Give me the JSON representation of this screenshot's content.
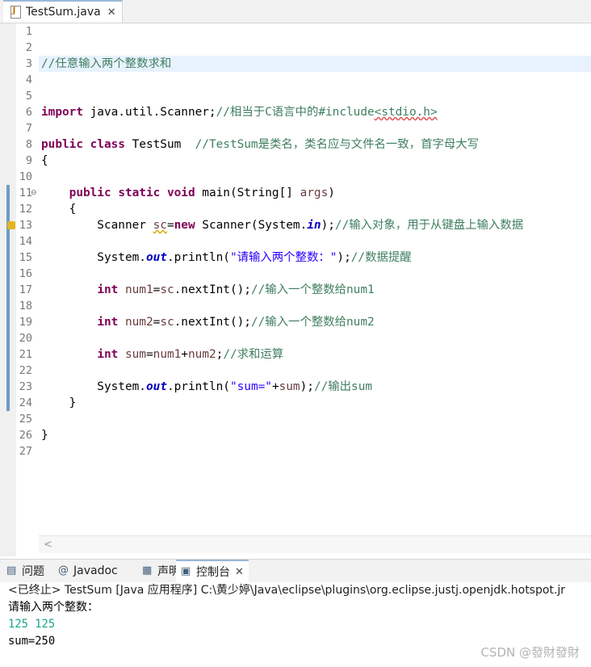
{
  "editor_tab": {
    "label": "TestSum.java",
    "close": "✕"
  },
  "lines": [
    {
      "n": "1",
      "parts": []
    },
    {
      "n": "2",
      "parts": []
    },
    {
      "n": "3",
      "hl": true,
      "parts": [
        {
          "c": "cm",
          "t": "//任意输入两个整数求和"
        }
      ]
    },
    {
      "n": "4",
      "parts": []
    },
    {
      "n": "5",
      "parts": []
    },
    {
      "n": "6",
      "parts": [
        {
          "c": "kw",
          "t": "import"
        },
        {
          "t": " java.util.Scanner;"
        },
        {
          "c": "cm",
          "t": "//相当于C语言中的#include"
        },
        {
          "c": "cm sqr",
          "t": "<stdio.h>"
        }
      ]
    },
    {
      "n": "7",
      "parts": []
    },
    {
      "n": "8",
      "parts": [
        {
          "c": "kw",
          "t": "public"
        },
        {
          "t": " "
        },
        {
          "c": "kw",
          "t": "class"
        },
        {
          "t": " TestSum  "
        },
        {
          "c": "cm",
          "t": "//TestSum是类名，类名应与文件名一致，首字母大写"
        }
      ]
    },
    {
      "n": "9",
      "parts": [
        {
          "t": "{"
        }
      ]
    },
    {
      "n": "10",
      "parts": []
    },
    {
      "n": "11",
      "fold": true,
      "parts": [
        {
          "t": "    "
        },
        {
          "c": "kw",
          "t": "public"
        },
        {
          "t": " "
        },
        {
          "c": "kw",
          "t": "static"
        },
        {
          "t": " "
        },
        {
          "c": "kw",
          "t": "void"
        },
        {
          "t": " main(String[] "
        },
        {
          "c": "lv",
          "t": "args"
        },
        {
          "t": ")"
        }
      ]
    },
    {
      "n": "12",
      "parts": [
        {
          "t": "    {"
        }
      ]
    },
    {
      "n": "13",
      "warn": true,
      "parts": [
        {
          "t": "        Scanner "
        },
        {
          "c": "lv sq",
          "t": "sc"
        },
        {
          "t": "="
        },
        {
          "c": "kw",
          "t": "new"
        },
        {
          "t": " Scanner(System."
        },
        {
          "c": "sf",
          "t": "in"
        },
        {
          "t": ");"
        },
        {
          "c": "cm",
          "t": "//输入对象，用于从键盘上输入数据"
        }
      ]
    },
    {
      "n": "14",
      "parts": []
    },
    {
      "n": "15",
      "parts": [
        {
          "t": "        System."
        },
        {
          "c": "sf",
          "t": "out"
        },
        {
          "t": ".println("
        },
        {
          "c": "st",
          "t": "\"请输入两个整数：\""
        },
        {
          "t": ");"
        },
        {
          "c": "cm",
          "t": "//数据提醒"
        }
      ]
    },
    {
      "n": "16",
      "parts": []
    },
    {
      "n": "17",
      "parts": [
        {
          "t": "        "
        },
        {
          "c": "kw",
          "t": "int"
        },
        {
          "t": " "
        },
        {
          "c": "lv",
          "t": "num1"
        },
        {
          "t": "="
        },
        {
          "c": "lv",
          "t": "sc"
        },
        {
          "t": ".nextInt();"
        },
        {
          "c": "cm",
          "t": "//输入一个整数给num1"
        }
      ]
    },
    {
      "n": "18",
      "parts": []
    },
    {
      "n": "19",
      "parts": [
        {
          "t": "        "
        },
        {
          "c": "kw",
          "t": "int"
        },
        {
          "t": " "
        },
        {
          "c": "lv",
          "t": "num2"
        },
        {
          "t": "="
        },
        {
          "c": "lv",
          "t": "sc"
        },
        {
          "t": ".nextInt();"
        },
        {
          "c": "cm",
          "t": "//输入一个整数给num2"
        }
      ]
    },
    {
      "n": "20",
      "parts": []
    },
    {
      "n": "21",
      "parts": [
        {
          "t": "        "
        },
        {
          "c": "kw",
          "t": "int"
        },
        {
          "t": " "
        },
        {
          "c": "lv",
          "t": "sum"
        },
        {
          "t": "="
        },
        {
          "c": "lv",
          "t": "num1"
        },
        {
          "t": "+"
        },
        {
          "c": "lv",
          "t": "num2"
        },
        {
          "t": ";"
        },
        {
          "c": "cm",
          "t": "//求和运算"
        }
      ]
    },
    {
      "n": "22",
      "parts": []
    },
    {
      "n": "23",
      "parts": [
        {
          "t": "        System."
        },
        {
          "c": "sf",
          "t": "out"
        },
        {
          "t": ".println("
        },
        {
          "c": "st",
          "t": "\"sum=\""
        },
        {
          "t": "+"
        },
        {
          "c": "lv",
          "t": "sum"
        },
        {
          "t": ");"
        },
        {
          "c": "cm",
          "t": "//输出sum"
        }
      ]
    },
    {
      "n": "24",
      "parts": [
        {
          "t": "    }"
        }
      ]
    },
    {
      "n": "25",
      "parts": []
    },
    {
      "n": "26",
      "parts": [
        {
          "t": "}"
        }
      ]
    },
    {
      "n": "27",
      "parts": []
    }
  ],
  "scroll_left": "<",
  "console_tabs": [
    {
      "name": "tab-problems",
      "icon": "problems-icon",
      "label": "问题"
    },
    {
      "name": "tab-javadoc",
      "icon": "javadoc-icon",
      "label": "Javadoc"
    },
    {
      "name": "tab-declaration",
      "icon": "declaration-icon",
      "label": "声明"
    },
    {
      "name": "tab-console",
      "icon": "console-icon",
      "label": "控制台",
      "close": "✕",
      "active": true
    }
  ],
  "console": {
    "header": "<已终止> TestSum [Java 应用程序] C:\\黄少婷\\Java\\eclipse\\plugins\\org.eclipse.justj.openjdk.hotspot.jr",
    "output": [
      {
        "text": "请输入两个整数：",
        "color": "#000000"
      },
      {
        "text": "125 125",
        "color": "#1aa58f"
      },
      {
        "text": "sum=250",
        "color": "#000000"
      }
    ]
  },
  "watermark": "CSDN @發財發財",
  "colors": {
    "keyword": "#7f0055",
    "comment": "#3f7f5f",
    "string": "#2a00ff",
    "field": "#0000c0",
    "local": "#6a3e3e",
    "user_input": "#1aa58f",
    "current_line": "#e8f2fe"
  }
}
